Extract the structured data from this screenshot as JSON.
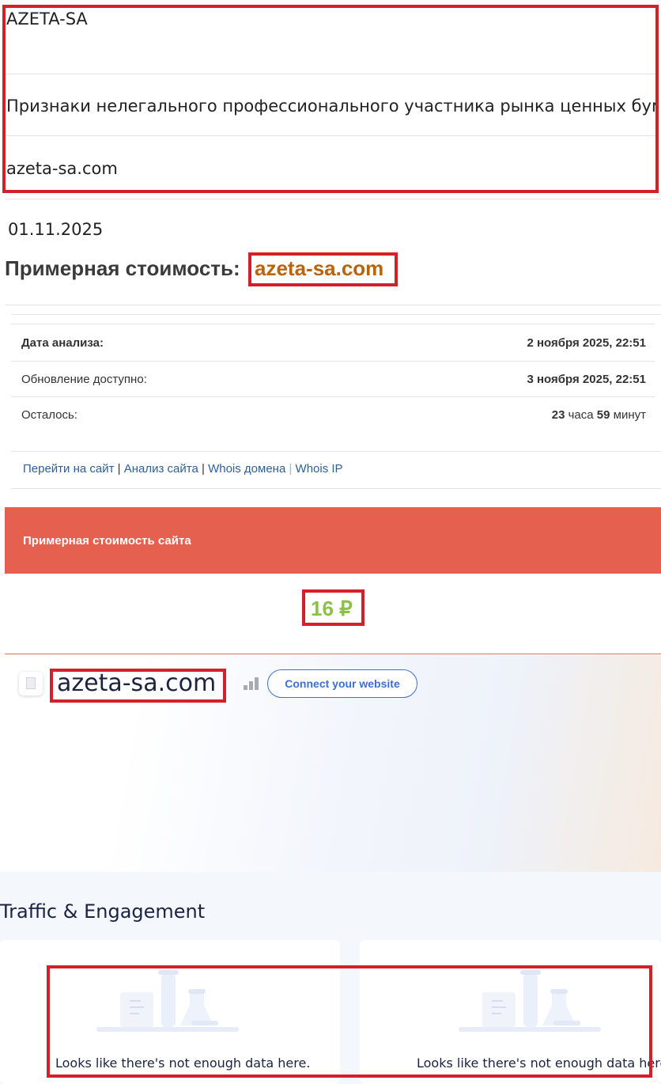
{
  "header": {
    "name": "AZETA-SA",
    "description": "Признаки нелегального профессионального участника рынка ценных бумаг",
    "domain": "azeta-sa.com"
  },
  "date": "01.11.2025",
  "cost_heading": {
    "label": "Примерная стоимость:",
    "domain": "azeta-sa.com"
  },
  "analysis": {
    "analysis_date_label": "Дата анализа:",
    "analysis_date_value": "2 ноября 2025, 22:51",
    "update_label": "Обновление доступно:",
    "update_value": "3 ноября 2025, 22:51",
    "remaining_label": "Осталось:",
    "remaining_hours": "23",
    "remaining_hours_unit": "часа",
    "remaining_minutes": "59",
    "remaining_minutes_unit": "минут"
  },
  "links": {
    "go_to_site": "Перейти на сайт",
    "site_analysis": "Анализ сайта",
    "whois_domain": "Whois домена",
    "whois_ip": "Whois IP",
    "separator": "|"
  },
  "site_cost": {
    "banner": "Примерная стоимость сайта",
    "price": "16 ₽"
  },
  "widget": {
    "domain": "azeta-sa.com",
    "connect_button": "Connect your website",
    "section_title": "Traffic & Engagement",
    "empty_left": "Looks like there's not enough data here.",
    "empty_right": "Looks like there's not enough data here."
  },
  "colors": {
    "highlight_border": "#d3202a",
    "banner": "#e66050",
    "price": "#8cc04a",
    "domain_accent": "#b8640e",
    "link": "#2d5f9a",
    "button": "#3b6fd6"
  }
}
